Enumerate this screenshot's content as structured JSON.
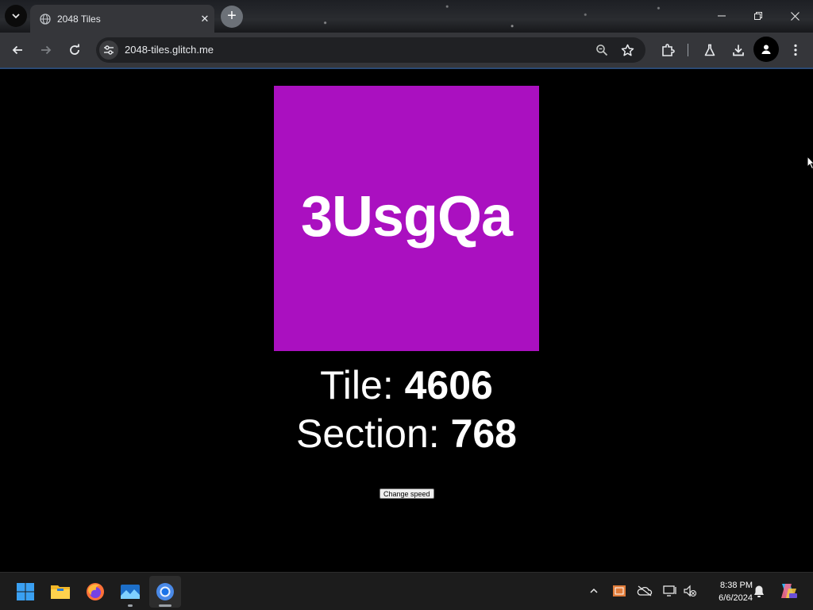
{
  "browser": {
    "tab": {
      "title": "2048 Tiles",
      "close_glyph": "✕"
    },
    "new_tab_glyph": "+",
    "tab_search_glyph": "⌄",
    "window_controls": {
      "minimize": "—",
      "restore": "❐",
      "close": "✕"
    },
    "address": {
      "url": "2048-tiles.glitch.me"
    },
    "accent_color": "#2b4a74"
  },
  "page": {
    "tile": {
      "label": "3UsgQa",
      "color": "#aa10c0"
    },
    "tile_line": {
      "label": "Tile: ",
      "value": "4606"
    },
    "section_line": {
      "label": "Section: ",
      "value": "768"
    },
    "change_speed_button": "Change speed"
  },
  "taskbar": {
    "apps": [
      "start-button",
      "file-explorer",
      "firefox",
      "photos",
      "chrome"
    ],
    "clock": {
      "time": "8:38 PM",
      "date": "6/6/2024"
    }
  }
}
